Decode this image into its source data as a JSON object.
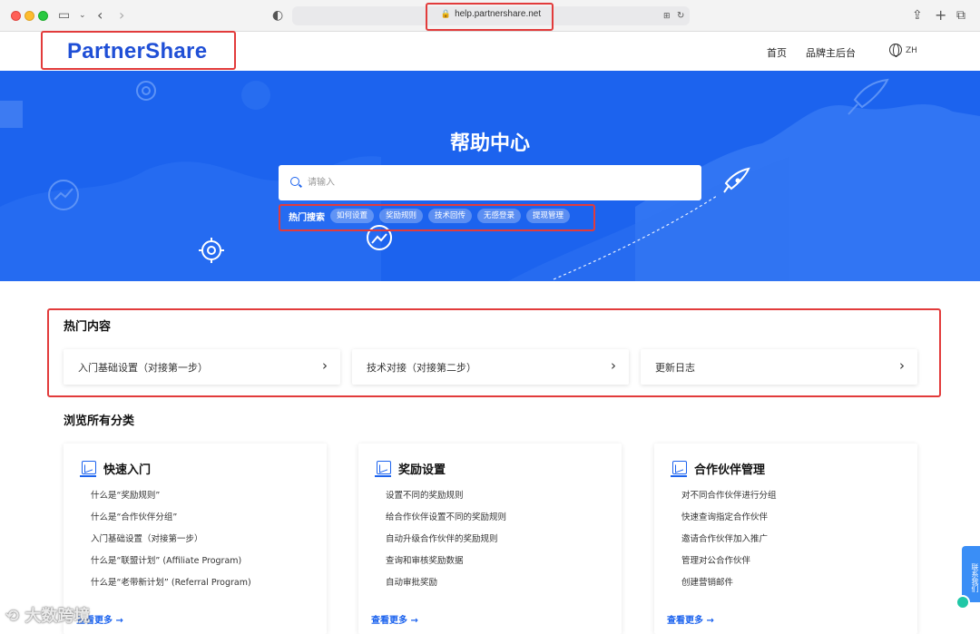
{
  "browser": {
    "url": "help.partnershare.net"
  },
  "header": {
    "logo": "PartnerShare",
    "nav": {
      "home": "首页",
      "brand_backend": "品牌主后台",
      "language": "ZH"
    }
  },
  "hero": {
    "title": "帮助中心",
    "search_placeholder": "请输入",
    "hot_search_label": "热门搜索",
    "hot_tags": [
      "如何设置",
      "奖励规则",
      "技术回传",
      "无感登录",
      "提现管理"
    ]
  },
  "hot_content": {
    "title": "热门内容",
    "items": [
      "入门基础设置（对接第一步）",
      "技术对接（对接第二步）",
      "更新日志"
    ]
  },
  "categories": {
    "title": "浏览所有分类",
    "more_label": "查看更多",
    "cards": [
      {
        "title": "快速入门",
        "items": [
          "什么是“奖励规则”",
          "什么是“合作伙伴分组”",
          "入门基础设置（对接第一步）",
          "什么是“联盟计划” (Affiliate Program)",
          "什么是“老带新计划” (Referral Program)"
        ]
      },
      {
        "title": "奖励设置",
        "items": [
          "设置不同的奖励规则",
          "给合作伙伴设置不同的奖励规则",
          "自动升级合作伙伴的奖励规则",
          "查询和审核奖励数据",
          "自动审批奖励"
        ]
      },
      {
        "title": "合作伙伴管理",
        "items": [
          "对不同合作伙伴进行分组",
          "快速查询指定合作伙伴",
          "邀请合作伙伴加入推广",
          "管理对公合作伙伴",
          "创建营销邮件"
        ]
      }
    ]
  },
  "contact": {
    "label": "联系我们"
  },
  "watermark": "大数跨境",
  "colors": {
    "primary": "#1c63ee",
    "highlight_box": "#e23b3b"
  }
}
